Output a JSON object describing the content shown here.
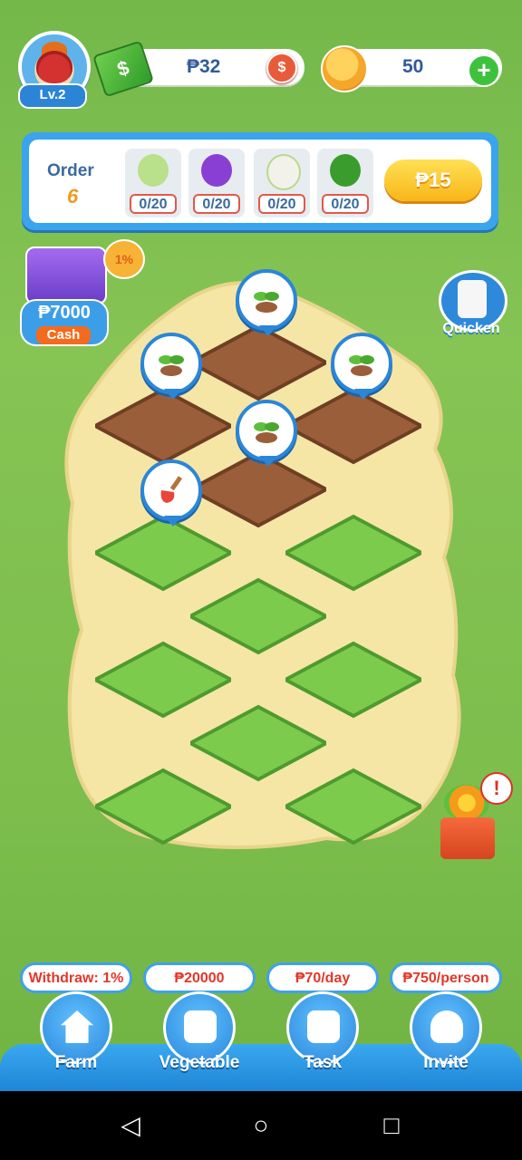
{
  "player": {
    "level": "Lv.2"
  },
  "currency": {
    "cash": "₱32",
    "coins": "50"
  },
  "order": {
    "title": "Order",
    "count": "6",
    "items": [
      {
        "icon": "cabbage-icon",
        "progress": "0/20",
        "color": "#b9e08a"
      },
      {
        "icon": "eggplant-icon",
        "progress": "0/20",
        "color": "#8a3fd4"
      },
      {
        "icon": "radish-icon",
        "progress": "0/20",
        "color": "#f2f2ea"
      },
      {
        "icon": "broccoli-icon",
        "progress": "0/20",
        "color": "#3a9c2c"
      }
    ],
    "reward": "₱15"
  },
  "side": {
    "gift_percent": "1%",
    "cash_amount": "₱7000",
    "cash_label": "Cash",
    "quicken_label": "Quicken",
    "alert": "!"
  },
  "nav": {
    "tags": [
      "Withdraw: 1%",
      "₱20000",
      "₱70/day",
      "₱750/person"
    ],
    "labels": [
      "Farm",
      "Vegetable",
      "Task",
      "Invite"
    ]
  },
  "colors": {
    "soil": "#9b5e3a",
    "grass": "#7ccb4c",
    "path": "#f5e6a6",
    "accent": "#2b86d8"
  }
}
